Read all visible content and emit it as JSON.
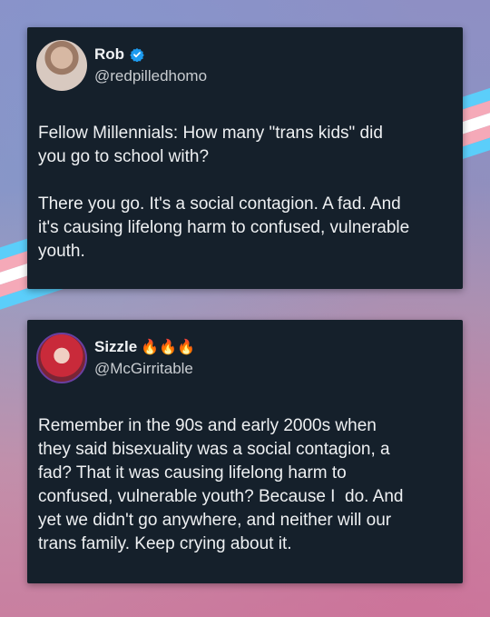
{
  "colors": {
    "card_bg": "#15202b",
    "verified_blue": "#1d9bf0",
    "stripe_blue": "#5bcefa",
    "stripe_pink": "#f5a9b8",
    "stripe_white": "#ffffff"
  },
  "tweets": [
    {
      "name": "Rob",
      "verified": true,
      "handle": "@redpilledhomo",
      "text": "Fellow Millennials: How many \"trans kids\" did\nyou go to school with?\n\nThere you go. It's a social contagion. A fad. And\nit's causing lifelong harm to confused, vulnerable\nyouth."
    },
    {
      "name": "Sizzle",
      "emoji": "🔥🔥🔥",
      "handle": "@McGirritable",
      "text": "Remember in the 90s and early 2000s when\nthey said bisexuality was a social contagion, a\nfad? That it was causing lifelong harm to\nconfused, vulnerable youth? Because I  do. And\nyet we didn't go anywhere, and neither will our\ntrans family. Keep crying about it."
    }
  ]
}
